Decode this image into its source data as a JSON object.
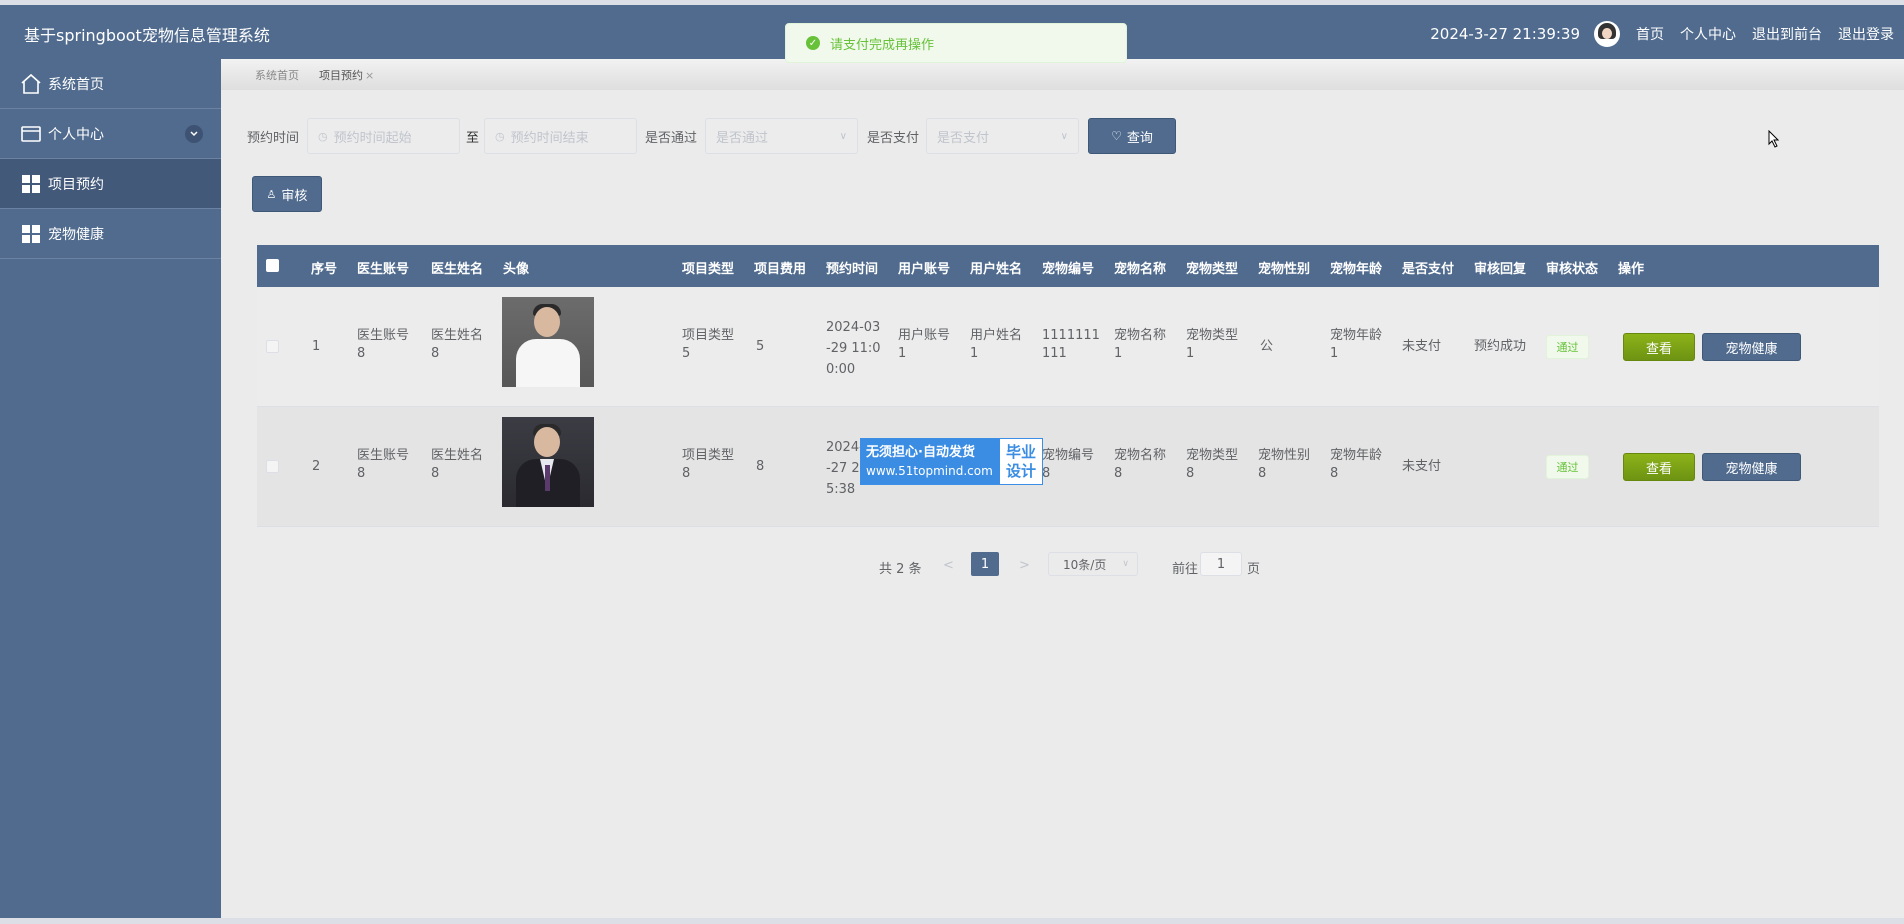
{
  "app": {
    "title": "基于springboot宠物信息管理系统"
  },
  "header": {
    "datetime": "2024-3-27 21:39:39",
    "links": [
      "首页",
      "个人中心",
      "退出到前台",
      "退出登录"
    ]
  },
  "toast": {
    "message": "请支付完成再操作"
  },
  "sidebar": {
    "items": [
      {
        "label": "系统首页",
        "icon": "home-icon"
      },
      {
        "label": "个人中心",
        "icon": "wallet-icon"
      },
      {
        "label": "项目预约",
        "icon": "grid-icon"
      },
      {
        "label": "宠物健康",
        "icon": "grid-icon"
      }
    ]
  },
  "breadcrumb": {
    "items": [
      "系统首页",
      "项目预约"
    ],
    "close": "×"
  },
  "search": {
    "time_label": "预约时间",
    "time_start_placeholder": "预约时间起始",
    "to_label": "至",
    "time_end_placeholder": "预约时间结束",
    "pass_label": "是否通过",
    "pass_placeholder": "是否通过",
    "pay_label": "是否支付",
    "pay_placeholder": "是否支付",
    "query_button": "查询"
  },
  "toolbar": {
    "audit_button": "审核"
  },
  "table": {
    "headers": [
      "序号",
      "医生账号",
      "医生姓名",
      "头像",
      "项目类型",
      "项目费用",
      "预约时间",
      "用户账号",
      "用户姓名",
      "宠物编号",
      "宠物名称",
      "宠物类型",
      "宠物性别",
      "宠物年龄",
      "是否支付",
      "审核回复",
      "审核状态",
      "操作"
    ],
    "rows": [
      {
        "index": "1",
        "doctor_account": [
          "医生账号",
          "8"
        ],
        "doctor_name": [
          "医生姓名",
          "8"
        ],
        "project_type": [
          "项目类型",
          "5"
        ],
        "fee": "5",
        "time": [
          "2024-03",
          "-29 11:0",
          "0:00"
        ],
        "user_account": [
          "用户账号",
          "1"
        ],
        "user_name": [
          "用户姓名",
          "1"
        ],
        "pet_no": [
          "1111111",
          "111"
        ],
        "pet_name": [
          "宠物名称",
          "1"
        ],
        "pet_type": [
          "宠物类型",
          "1"
        ],
        "pet_gender": [
          "公",
          ""
        ],
        "pet_age": [
          "宠物年龄",
          "1"
        ],
        "paid": "未支付",
        "reply": "预约成功",
        "status": "通过",
        "view": "查看",
        "health": "宠物健康"
      },
      {
        "index": "2",
        "doctor_account": [
          "医生账号",
          "8"
        ],
        "doctor_name": [
          "医生姓名",
          "8"
        ],
        "project_type": [
          "项目类型",
          "8"
        ],
        "fee": "8",
        "time": [
          "2024-",
          "-27 2",
          "5:38"
        ],
        "user_account": [
          "",
          ""
        ],
        "user_name": [
          "",
          ""
        ],
        "pet_no": [
          "宠物编号",
          "8"
        ],
        "pet_name": [
          "宠物名称",
          "8"
        ],
        "pet_type": [
          "宠物类型",
          "8"
        ],
        "pet_gender": [
          "宠物性别",
          "8"
        ],
        "pet_age": [
          "宠物年龄",
          "8"
        ],
        "paid": "未支付",
        "reply": "",
        "status": "通过",
        "view": "查看",
        "health": "宠物健康"
      }
    ]
  },
  "pagination": {
    "total": "共 2 条",
    "prev": "<",
    "current": "1",
    "next": ">",
    "page_size": "10条/页",
    "goto_label": "前往",
    "goto_value": "1",
    "page_suffix": "页"
  },
  "watermark": {
    "line1": "无须担心·自动发货",
    "line2": "www.51topmind.com",
    "right1": "毕业",
    "right2": "设计"
  },
  "colors": {
    "primary": "#506b8e",
    "success": "#67c23a",
    "green_button": "#7ba317",
    "background": "#ebebeb"
  }
}
